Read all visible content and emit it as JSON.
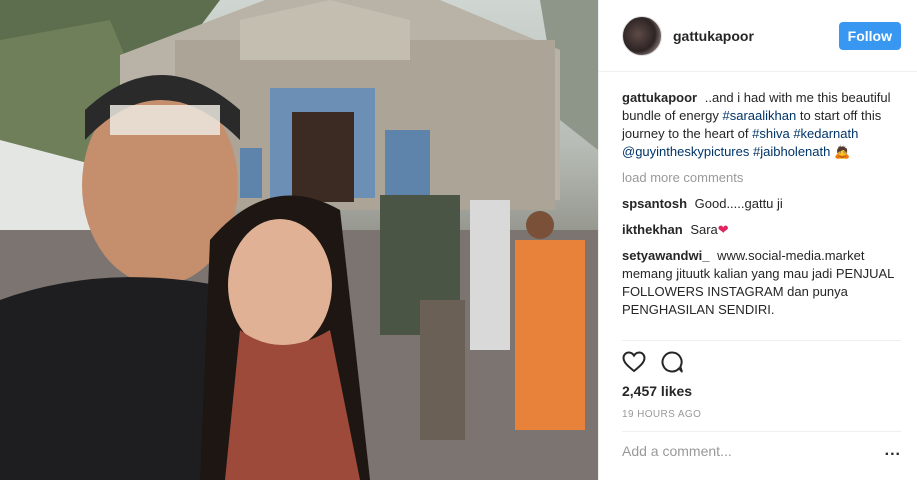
{
  "header": {
    "username": "gattukapoor",
    "follow_label": "Follow"
  },
  "caption": {
    "username": "gattukapoor",
    "text_1": "..and i had with me this beautiful bundle of energy",
    "tag_saraalikhan": "#saraalikhan",
    "text_2": "to start off this journey to the heart of",
    "tag_shiva": "#shiva",
    "tag_kedarnath": "#kedarnath",
    "mention_guyintheskypictures": "@guyintheskypictures",
    "tag_jaibholenath": "#jaibholenath",
    "emoji": "🙇"
  },
  "load_more_label": "load more comments",
  "comments": [
    {
      "username": "spsantosh",
      "text": "Good.....gattu ji"
    },
    {
      "username": "ikthekhan",
      "text": "Sara",
      "emoji": "❤"
    },
    {
      "username": "setyawandwi_",
      "text": "www.social-media.market memang jituutk kalian yang mau jadi PENJUAL FOLLOWERS INSTAGRAM dan punya PENGHASILAN SENDIRI."
    }
  ],
  "likes_label": "2,457 likes",
  "timestamp": "19 HOURS AGO",
  "add_comment_placeholder": "Add a comment...",
  "more_label": "...",
  "icons": {
    "like": "heart-icon",
    "comment": "comment-icon",
    "more": "more-options-icon"
  },
  "colors": {
    "follow_button": "#3897f0",
    "link": "#003569",
    "muted": "#999999"
  }
}
